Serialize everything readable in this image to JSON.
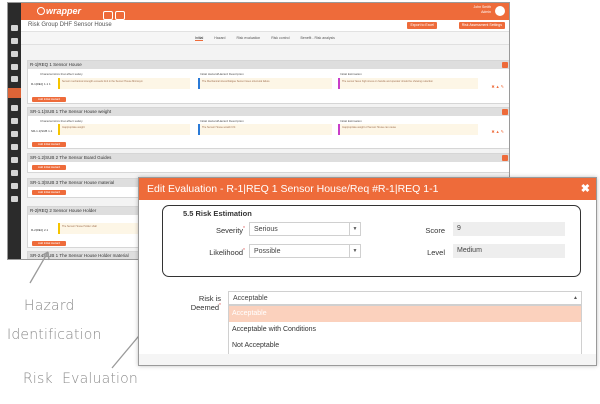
{
  "app": {
    "logo": "wrapper",
    "user_name": "John Smith",
    "user_role": "Admin",
    "page_title": "Risk Group DHF Sensor House",
    "header_buttons": [
      "Export to Excel",
      "Risk Assessment Settings"
    ],
    "tabs": [
      "Initial",
      "Hazard",
      "Risk evaluation",
      "Risk control",
      "Benefit - Risk analysis"
    ]
  },
  "hazards": [
    {
      "header": "R-1|REQ 1 Sensor House",
      "row_id": "R-1|REQ 1.1 1",
      "col1_label": "Characteristics that affect safety",
      "col1_text": "Sensor mechanical strength exceeds limit in the Sensor House Microsym",
      "col2_label": "Initial Hazard/Hazard Description",
      "col2_text": "The Mechanical stress/Fatigue Sensor loses structural failure",
      "col3_label": "Initial Estimation",
      "col3_text": "The sensor faces high stress on handle and operator should be showing reduction",
      "add_label": "Add Initial Hazard"
    },
    {
      "header": "SR-1.1|SUB 1 The Sensor House weight",
      "row_id": "SR-1.1|SUB 1.1",
      "col1_label": "Characteristics that affect safety",
      "col1_text": "Inappropriate weight",
      "col2_label": "Initial Hazard/Hazard Description",
      "col2_text": "The Sensor House wouldn't fit",
      "col3_label": "Initial Estimation",
      "col3_text": "Inappropriate weight of Sensor House can cause",
      "add_label": "Add Initial Hazard"
    },
    {
      "header": "SR-1.2|SUB 2 The Sensor Board Guides",
      "add_label": "Add Initial Hazard"
    },
    {
      "header": "SR-1.3|SUB 3 The Sensor House material",
      "add_label": "Add Initial Hazard"
    },
    {
      "header": "R-2|REQ 2 Sensor House Holder",
      "row_id": "R-2|REQ 2.1",
      "col1_text": "The Sensor House Holder shall",
      "add_label": "Add Initial Hazard"
    },
    {
      "header": "SR-2.1|SUB 1 The Sensor House Holder material"
    }
  ],
  "modal": {
    "title": "Edit Evaluation - R-1|REQ 1 Sensor House/Req #R-1|REQ 1-1",
    "close_glyph": "✖",
    "section_title": "5.5 Risk Estimation",
    "severity_label": "Severity",
    "severity_value": "Serious",
    "likelihood_label": "Likelihood",
    "likelihood_value": "Possible",
    "score_label": "Score",
    "score_value": "9",
    "level_label": "Level",
    "level_value": "Medium",
    "deemed_label": "Risk is Deemed",
    "deemed_value": "Acceptable",
    "options": [
      "Acceptable",
      "Acceptable with Conditions",
      "Not Acceptable"
    ],
    "highlighted_option": "Acceptable"
  },
  "annotations": {
    "hazard_line1": "Hazard",
    "hazard_line2": "Identification",
    "evaluation": "Risk  Evaluation"
  },
  "colors": {
    "accent": "#ee6b3a",
    "sidebar": "#2b2b2b",
    "highlight": "#fbd1bd",
    "annotation": "#8a8a8a"
  }
}
